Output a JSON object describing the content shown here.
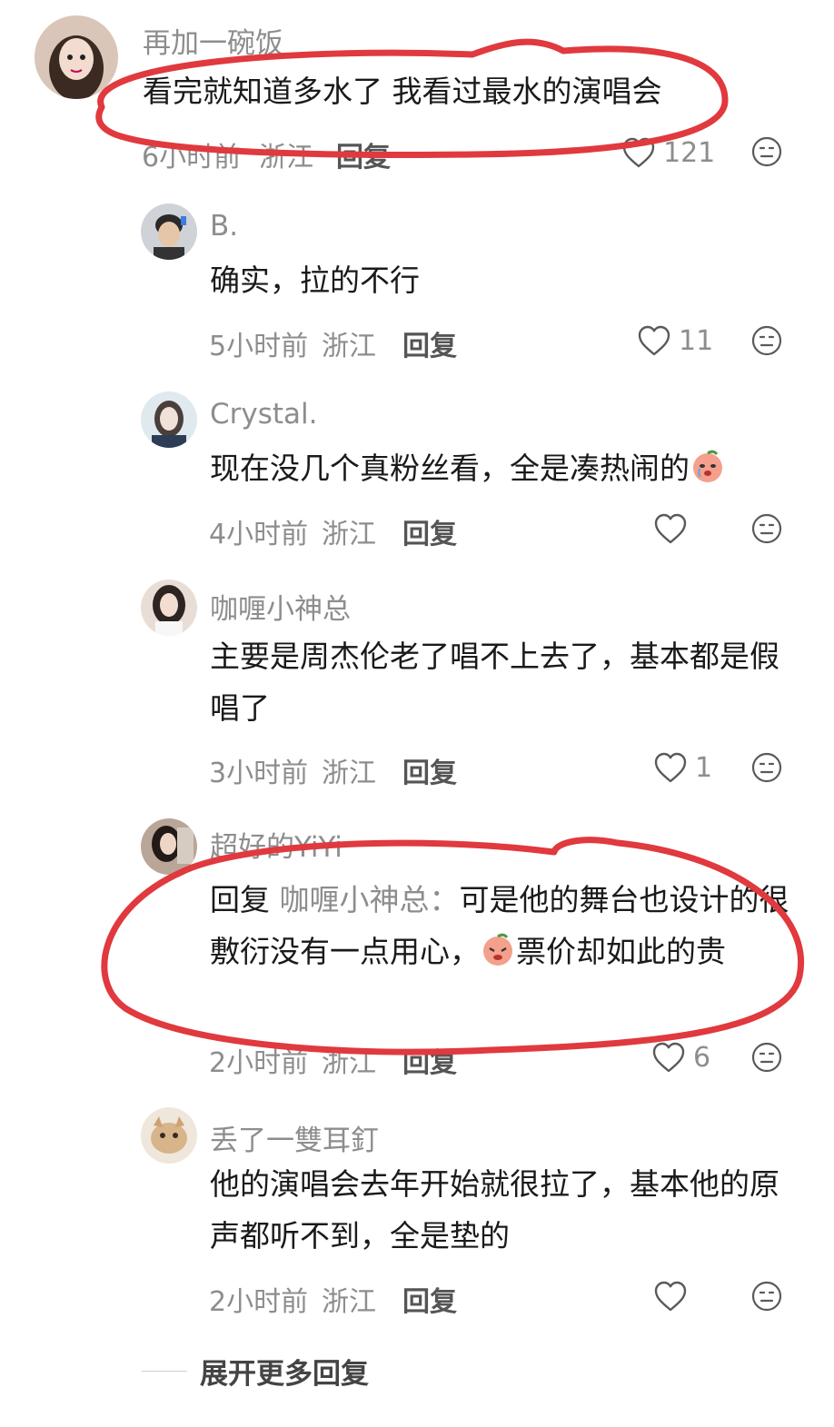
{
  "comments": [
    {
      "name": "再加一碗饭",
      "text": "看完就知道多水了 我看过最水的演唱会",
      "time": "6小时前",
      "region": "浙江",
      "reply": "回复",
      "likes": "121"
    },
    {
      "name": "B.",
      "text": "确实，拉的不行",
      "time": "5小时前",
      "region": "浙江",
      "reply": "回复",
      "likes": "11"
    },
    {
      "name": "Crystal.",
      "text": "现在没几个真粉丝看，全是凑热闹的",
      "time": "4小时前",
      "region": "浙江",
      "reply": "回复",
      "likes": ""
    },
    {
      "name": "咖喱小神总",
      "text": "主要是周杰伦老了唱不上去了，基本都是假唱了",
      "time": "3小时前",
      "region": "浙江",
      "reply": "回复",
      "likes": "1"
    },
    {
      "name": "超好的YiYi",
      "reply_prefix": "回复",
      "mention": "咖喱小神总",
      "mention_sep": "：",
      "text_part1": "可是他的舞台也设计的很敷衍没有一点用心，",
      "text_part2": "票价却如此的贵",
      "time": "2小时前",
      "region": "浙江",
      "reply": "回复",
      "likes": "6"
    },
    {
      "name": "丢了一雙耳釘",
      "text": "他的演唱会去年开始就很拉了，基本他的原声都听不到，全是垫的",
      "time": "2小时前",
      "region": "浙江",
      "reply": "回复",
      "likes": ""
    }
  ],
  "expand_more": "展开更多回复",
  "colors": {
    "annotation": "#e0393e",
    "meta": "#8d8d8d",
    "text": "#1a1a1a"
  },
  "icons": {
    "like": "heart-outline-icon",
    "dislike": "frown-face-icon"
  }
}
